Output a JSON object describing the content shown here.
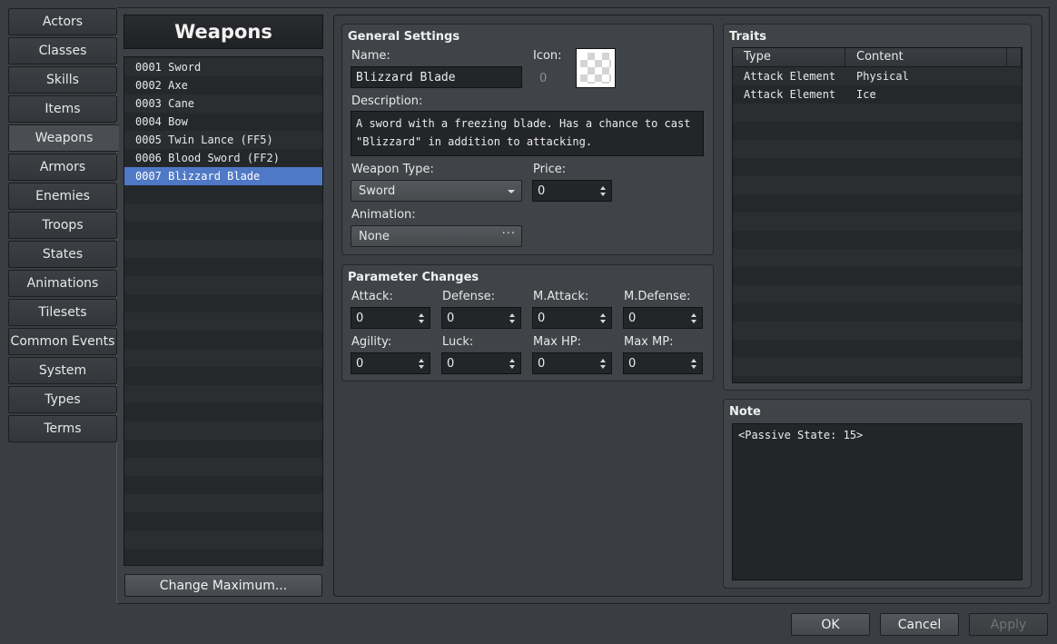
{
  "categories": [
    {
      "label": "Actors"
    },
    {
      "label": "Classes"
    },
    {
      "label": "Skills"
    },
    {
      "label": "Items"
    },
    {
      "label": "Weapons",
      "selected": true
    },
    {
      "label": "Armors"
    },
    {
      "label": "Enemies"
    },
    {
      "label": "Troops"
    },
    {
      "label": "States"
    },
    {
      "label": "Animations"
    },
    {
      "label": "Tilesets"
    },
    {
      "label": "Common Events"
    },
    {
      "label": "System"
    },
    {
      "label": "Types"
    },
    {
      "label": "Terms"
    }
  ],
  "list": {
    "title": "Weapons",
    "items": [
      "0001 Sword",
      "0002 Axe",
      "0003 Cane",
      "0004 Bow",
      "0005 Twin Lance (FF5)",
      "0006 Blood Sword (FF2)",
      "0007 Blizzard Blade"
    ],
    "selected_index": 6,
    "change_max_label": "Change Maximum..."
  },
  "general": {
    "title": "General Settings",
    "name_label": "Name:",
    "name_value": "Blizzard Blade",
    "icon_label": "Icon:",
    "icon_index": "0",
    "description_label": "Description:",
    "description_line1": "A sword with a freezing blade. Has a chance to cast",
    "description_line2": "\"Blizzard\" in addition to attacking.",
    "weapon_type_label": "Weapon Type:",
    "weapon_type_value": "Sword",
    "price_label": "Price:",
    "price_value": "0",
    "animation_label": "Animation:",
    "animation_value": "None",
    "animation_dots": "···"
  },
  "params": {
    "title": "Parameter Changes",
    "fields": [
      {
        "label": "Attack:",
        "value": "0"
      },
      {
        "label": "Defense:",
        "value": "0"
      },
      {
        "label": "M.Attack:",
        "value": "0"
      },
      {
        "label": "M.Defense:",
        "value": "0"
      },
      {
        "label": "Agility:",
        "value": "0"
      },
      {
        "label": "Luck:",
        "value": "0"
      },
      {
        "label": "Max HP:",
        "value": "0"
      },
      {
        "label": "Max MP:",
        "value": "0"
      }
    ]
  },
  "traits": {
    "title": "Traits",
    "col_type": "Type",
    "col_content": "Content",
    "rows": [
      {
        "type": "Attack Element",
        "content": "Physical"
      },
      {
        "type": "Attack Element",
        "content": "Ice"
      }
    ]
  },
  "note": {
    "title": "Note",
    "value": "<Passive State: 15>"
  },
  "footer": {
    "ok_label": "OK",
    "cancel_label": "Cancel",
    "apply_label": "Apply"
  },
  "colors": {
    "selection": "#4f79c6",
    "background": "#3a3d41"
  }
}
